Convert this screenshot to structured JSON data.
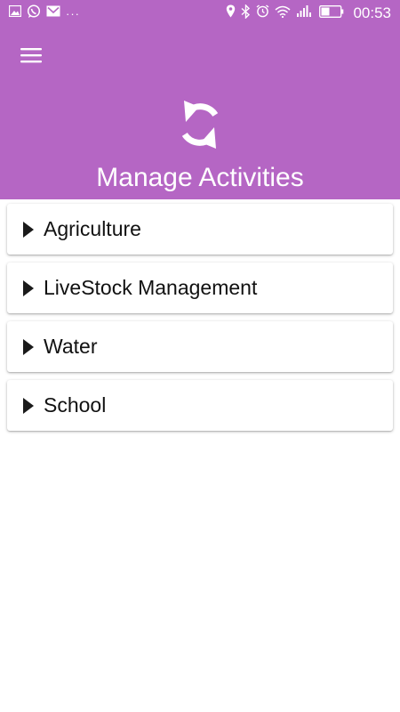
{
  "status_bar": {
    "time": "00:53",
    "dots": "···",
    "left_icons": [
      "gallery-icon",
      "whatsapp-icon",
      "gmail-icon"
    ],
    "right_icons": [
      "location-icon",
      "bluetooth-icon",
      "alarm-icon",
      "wifi-icon",
      "signal-icon",
      "battery-icon"
    ]
  },
  "header": {
    "title": "Manage Activities",
    "menu_icon": "hamburger-menu-icon",
    "sync_icon": "sync-icon",
    "background_color": "#b566c4"
  },
  "activities": [
    {
      "label": "Agriculture",
      "icon": "caret-right-icon"
    },
    {
      "label": "LiveStock Management",
      "icon": "caret-right-icon"
    },
    {
      "label": "Water",
      "icon": "caret-right-icon"
    },
    {
      "label": "School",
      "icon": "caret-right-icon"
    }
  ]
}
